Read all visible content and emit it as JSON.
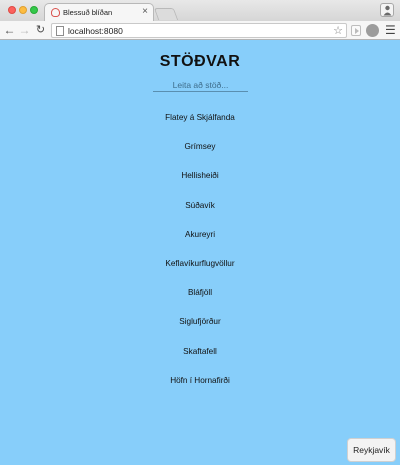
{
  "browser": {
    "tab_title": "Blessuð blíðan",
    "tab_close": "×",
    "url": "localhost:8080"
  },
  "page": {
    "title": "STÖÐVAR",
    "search_placeholder": "Leita að stöð...",
    "stations": [
      "Flatey á Skjálfanda",
      "Grímsey",
      "Hellisheiði",
      "Súðavík",
      "Akureyri",
      "Keflavíkurflugvöllur",
      "Bláfjöll",
      "Siglufjörður",
      "Skaftafell",
      "Höfn í Hornafirði"
    ],
    "corner_button": "Reykjavík"
  },
  "colors": {
    "page_background": "#87cefa",
    "button_background": "#f3f3f3"
  },
  "icons": {
    "back": "arrow-left-icon",
    "forward": "arrow-right-icon",
    "reload": "reload-icon",
    "bookmark": "star-icon",
    "menu": "hamburger-menu-icon"
  }
}
